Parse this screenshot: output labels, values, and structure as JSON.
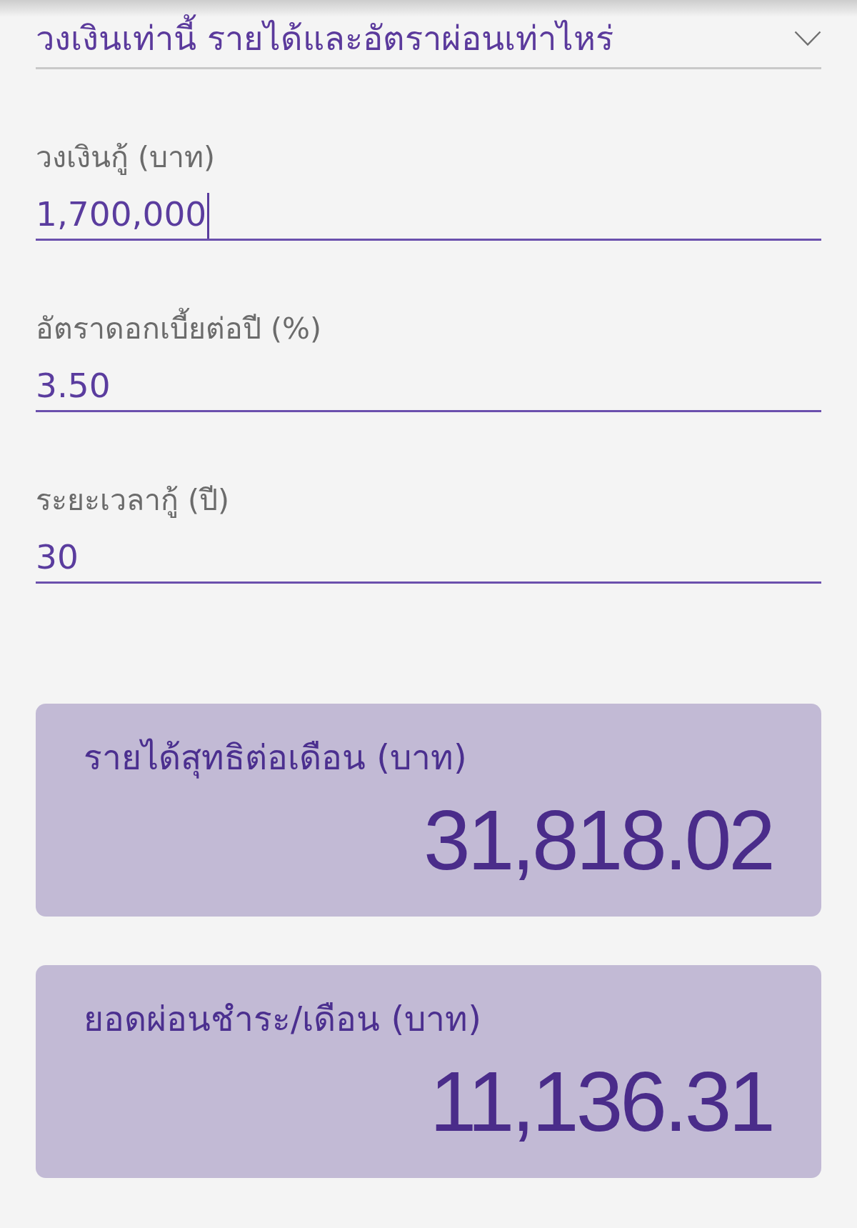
{
  "section": {
    "title": "วงเงินเท่านี้ รายได้และอัตราผ่อนเท่าไหร่"
  },
  "fields": [
    {
      "label": "วงเงินกู้ (บาท)",
      "value": "1,700,000",
      "focused": true
    },
    {
      "label": "อัตราดอกเบี้ยต่อปี (%)",
      "value": "3.50",
      "focused": false
    },
    {
      "label": "ระยะเวลากู้ (ปี)",
      "value": "30",
      "focused": false
    }
  ],
  "results": [
    {
      "label": "รายได้สุทธิต่อเดือน (บาท)",
      "value": "31,818.02"
    },
    {
      "label": "ยอดผ่อนชำระ/เดือน (บาท)",
      "value": "11,136.31"
    }
  ]
}
